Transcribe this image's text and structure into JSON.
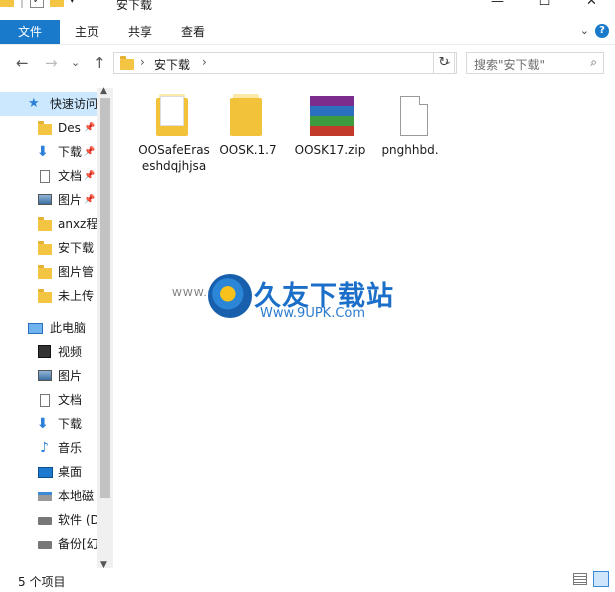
{
  "window": {
    "title": "安下载",
    "minimize": "—",
    "maximize": "☐",
    "close": "✕"
  },
  "ribbon": {
    "tabs": [
      "文件",
      "主页",
      "共享",
      "查看"
    ],
    "active_tab_color": "#1979ca",
    "help": "?"
  },
  "address": {
    "back": "←",
    "forward": "→",
    "dropdown": "⌄",
    "up": "↑",
    "crumb": "安下载",
    "search_placeholder": "搜索\"安下载\"",
    "refresh": "↻"
  },
  "nav": {
    "items": [
      {
        "label": "快速访问",
        "icon": "star-icon"
      },
      {
        "label": "Des",
        "icon": "folder-icon",
        "pinned": true
      },
      {
        "label": "下载",
        "icon": "download-icon",
        "pinned": true
      },
      {
        "label": "文档",
        "icon": "document-icon",
        "pinned": true
      },
      {
        "label": "图片",
        "icon": "picture-icon",
        "pinned": true
      },
      {
        "label": "anxz程",
        "icon": "folder-icon"
      },
      {
        "label": "安下载",
        "icon": "folder-icon"
      },
      {
        "label": "图片管",
        "icon": "folder-icon"
      },
      {
        "label": "未上传",
        "icon": "folder-icon"
      },
      {
        "label": "此电脑",
        "icon": "computer-icon"
      },
      {
        "label": "视频",
        "icon": "video-icon"
      },
      {
        "label": "图片",
        "icon": "picture-icon"
      },
      {
        "label": "文档",
        "icon": "document-icon"
      },
      {
        "label": "下载",
        "icon": "download-icon"
      },
      {
        "label": "音乐",
        "icon": "music-icon"
      },
      {
        "label": "桌面",
        "icon": "desktop-icon"
      },
      {
        "label": "本地磁",
        "icon": "windows-drive-icon"
      },
      {
        "label": "软件 (D",
        "icon": "drive-icon"
      },
      {
        "label": "备份[幻",
        "icon": "drive-icon"
      }
    ]
  },
  "files": [
    {
      "name": "OOSafeEraseshdqjhjsa",
      "type": "folder-doc"
    },
    {
      "name": "OOSK.1.7",
      "type": "folder"
    },
    {
      "name": "OOSK17.zip",
      "type": "archive"
    },
    {
      "name": "pnghhbd.",
      "type": "blank"
    }
  ],
  "watermark": {
    "title": "久友下载站",
    "url": "Www.9UPK.Com",
    "www": "WWW.9U"
  },
  "status": {
    "count": "5 个项目"
  }
}
